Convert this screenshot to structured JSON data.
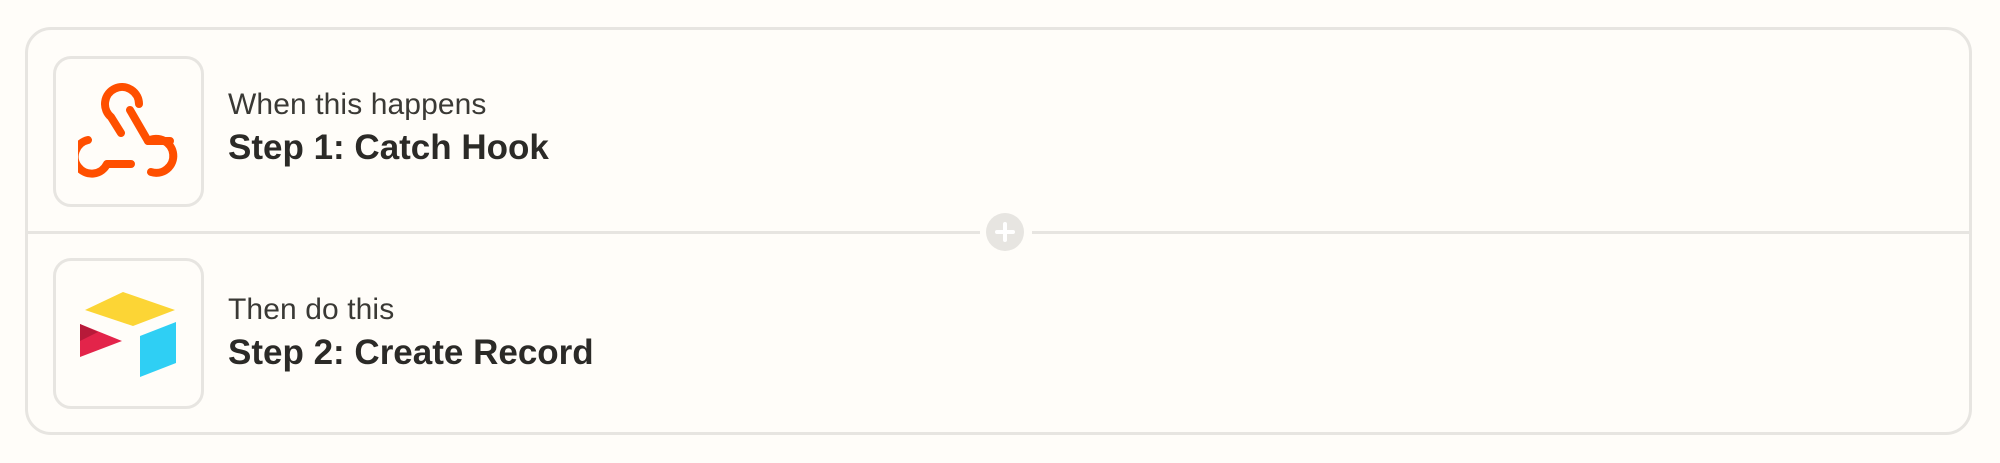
{
  "steps": [
    {
      "eyebrow": "When this happens",
      "title": "Step 1: Catch Hook",
      "icon": "webhook-icon",
      "icon_color": "#ff4f00"
    },
    {
      "eyebrow": "Then do this",
      "title": "Step 2: Create Record",
      "icon": "airtable-icon",
      "icon_colors": [
        "#fcb400",
        "#18bfff",
        "#f82b60"
      ]
    }
  ],
  "colors": {
    "background": "#fffdf9",
    "border": "#e7e5e1",
    "text": "#2b2a27"
  }
}
